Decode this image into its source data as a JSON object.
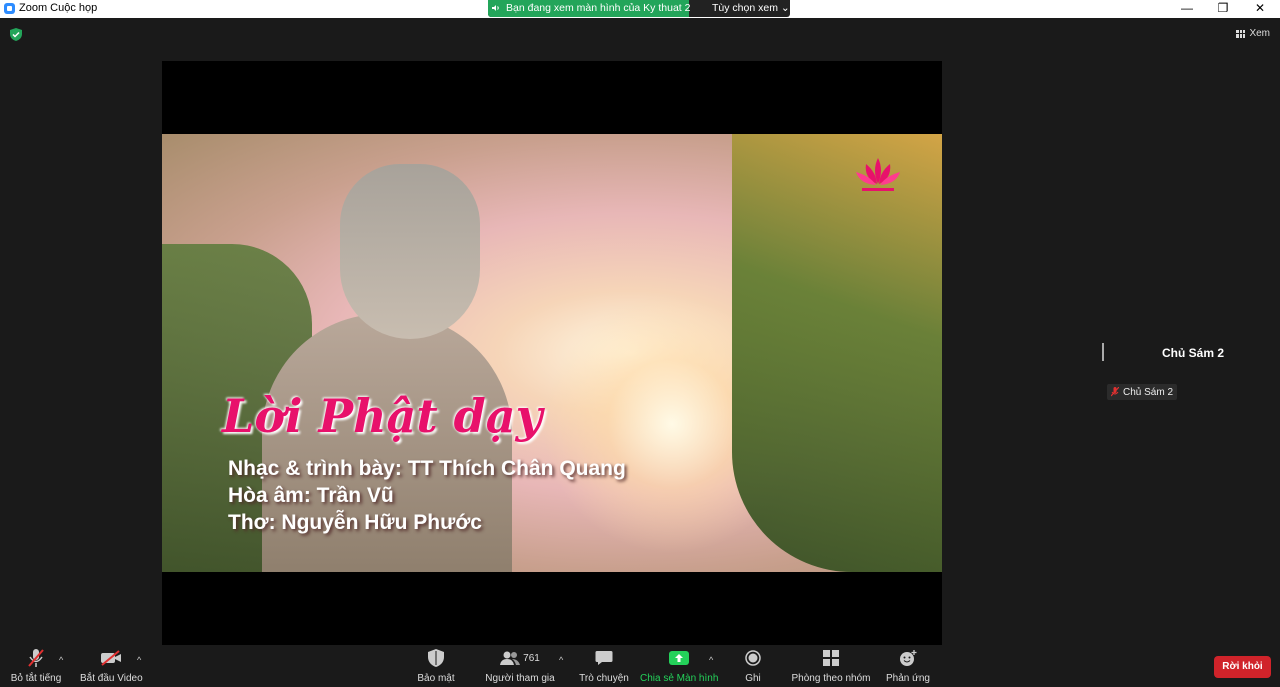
{
  "window": {
    "title": "Zoom Cuộc họp",
    "share_banner_text": "Bạn đang xem màn hình của Ky thuat 2",
    "view_options": "Tùy chọn xem ⌄",
    "minimize": "—",
    "restore": "❐",
    "close": "✕"
  },
  "top_right": {
    "view_label": "Xem"
  },
  "shared_content": {
    "title": "Lời Phật dạy",
    "credits": [
      "Nhạc & trình bày: TT Thích Chân Quang",
      "Hòa âm: Trần Vũ",
      "Thơ: Nguyễn Hữu Phước"
    ]
  },
  "participant": {
    "name": "Chủ Sám 2",
    "tag_name": "Chủ Sám 2"
  },
  "toolbar": {
    "mute": "Bỏ tắt tiếng",
    "video": "Bắt đầu Video",
    "security": "Bảo mật",
    "participants": "Người tham gia",
    "participants_count": "761",
    "chat": "Trò chuyện",
    "share": "Chia sẻ Màn hình",
    "record": "Ghi",
    "breakout": "Phòng theo nhóm",
    "reactions": "Phản ứng",
    "leave": "Rời khỏi"
  },
  "icons": {
    "app": "zoom-app-icon",
    "security": "shield-icon",
    "mute": "mic-muted-icon",
    "video": "video-off-icon",
    "participants": "people-icon",
    "chat": "chat-bubble-icon",
    "share": "share-up-arrow-icon",
    "record": "record-icon",
    "breakout": "grid-icon",
    "reactions": "smiley-icon"
  },
  "colors": {
    "share_green": "#23a55a",
    "active_green": "#24d15a",
    "leave_red": "#d0232a",
    "title_pink": "#e8116b"
  }
}
